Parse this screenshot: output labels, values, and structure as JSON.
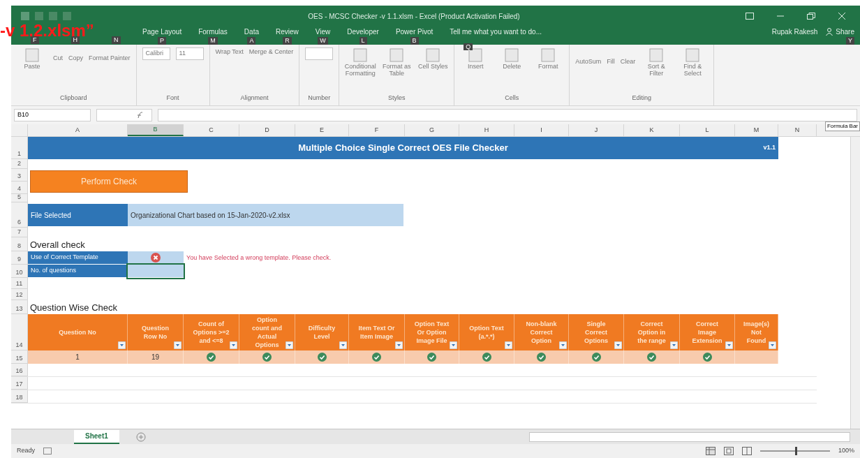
{
  "window": {
    "title": "OES - MCSC Checker -v 1.1.xlsm - Excel (Product Activation Failed)",
    "user": "Rupak Rakesh",
    "share": "Share",
    "share_keytip": "Y"
  },
  "overlay_caption": "-v 1.2.xlsm”",
  "covered_tab_keytips": [
    "F",
    "H",
    "N"
  ],
  "tabs": [
    {
      "label": "Page Layout",
      "keytip": "P"
    },
    {
      "label": "Formulas",
      "keytip": "M"
    },
    {
      "label": "Data",
      "keytip": "A"
    },
    {
      "label": "Review",
      "keytip": "R"
    },
    {
      "label": "View",
      "keytip": "W"
    },
    {
      "label": "Developer",
      "keytip": "L"
    },
    {
      "label": "Power Pivot",
      "keytip": "B"
    }
  ],
  "tell_me": {
    "label": "Tell me what you want to do...",
    "keytip": "Q"
  },
  "ribbon": [
    {
      "label": "Clipboard",
      "items": [
        {
          "kind": "large",
          "label": "Paste"
        },
        {
          "kind": "small",
          "label": "Cut"
        },
        {
          "kind": "small",
          "label": "Copy"
        },
        {
          "kind": "small",
          "label": "Format Painter"
        }
      ]
    },
    {
      "label": "Font",
      "items": [
        {
          "kind": "field",
          "label": "Calibri"
        },
        {
          "kind": "field",
          "label": "11"
        }
      ]
    },
    {
      "label": "Alignment",
      "items": [
        {
          "kind": "small",
          "label": "Wrap Text"
        },
        {
          "kind": "small",
          "label": "Merge & Center"
        }
      ]
    },
    {
      "label": "Number",
      "items": [
        {
          "kind": "field"
        }
      ]
    },
    {
      "label": "Styles",
      "items": [
        {
          "kind": "large",
          "label": "Conditional Formatting"
        },
        {
          "kind": "large",
          "label": "Format as Table"
        },
        {
          "kind": "large",
          "label": "Cell Styles"
        }
      ]
    },
    {
      "label": "Cells",
      "items": [
        {
          "kind": "large",
          "label": "Insert"
        },
        {
          "kind": "large",
          "label": "Delete"
        },
        {
          "kind": "large",
          "label": "Format"
        }
      ]
    },
    {
      "label": "Editing",
      "items": [
        {
          "kind": "small",
          "label": "AutoSum"
        },
        {
          "kind": "small",
          "label": "Fill"
        },
        {
          "kind": "small",
          "label": "Clear"
        },
        {
          "kind": "large",
          "label": "Sort & Filter"
        },
        {
          "kind": "large",
          "label": "Find & Select"
        }
      ]
    }
  ],
  "formula_bar": {
    "name_box": "B10",
    "tooltip": "Formula Bar"
  },
  "columns": [
    {
      "label": "A",
      "selected": false
    },
    {
      "label": "B",
      "selected": true
    },
    {
      "label": "C",
      "selected": false
    },
    {
      "label": "D",
      "selected": false
    },
    {
      "label": "E",
      "selected": false
    },
    {
      "label": "F",
      "selected": false
    },
    {
      "label": "G",
      "selected": false
    },
    {
      "label": "H",
      "selected": false
    },
    {
      "label": "I",
      "selected": false
    },
    {
      "label": "J",
      "selected": false
    },
    {
      "label": "K",
      "selected": false
    },
    {
      "label": "L",
      "selected": false
    },
    {
      "label": "M",
      "selected": false
    },
    {
      "label": "N",
      "selected": false
    }
  ],
  "row_numbers": [
    "1",
    "2",
    "3",
    "4",
    "5",
    "6",
    "7",
    "8",
    "9",
    "10",
    "11",
    "12",
    "13",
    "14",
    "15",
    "16",
    "17",
    "18"
  ],
  "sheet": {
    "title": "Multiple Choice Single Correct OES File Checker",
    "version": "v1.1",
    "perform_button": "Perform Check",
    "file_label": "File Selected",
    "file_value": "Organizational Chart based on 15-Jan-2020-v2.xlsx",
    "overall_heading": "Overall check",
    "checks": [
      {
        "label": "Use of Correct Template",
        "kind": "error",
        "message": "You have Selected a wrong template. Please check."
      },
      {
        "label": "No. of questions",
        "kind": "empty"
      }
    ],
    "question_heading": "Question Wise Check",
    "headers": [
      "Question No",
      "Question Row No",
      "Count of Options >=2 and <=8",
      "Option count and Actual Options",
      "Difficulty Level",
      "Item Text Or Item Image",
      "Option Text Or Option Image File",
      "Option Text (a.*.*)",
      "Non-blank Correct Option",
      "Single Correct Options",
      "Correct Option in the range",
      "Correct Image Extension",
      "Image(s) Not Found"
    ],
    "rows": [
      {
        "cells": [
          {
            "kind": "text",
            "value": "1"
          },
          {
            "kind": "text",
            "value": "19"
          },
          {
            "kind": "ok"
          },
          {
            "kind": "ok"
          },
          {
            "kind": "ok"
          },
          {
            "kind": "ok"
          },
          {
            "kind": "ok"
          },
          {
            "kind": "ok"
          },
          {
            "kind": "ok"
          },
          {
            "kind": "ok"
          },
          {
            "kind": "ok"
          },
          {
            "kind": "ok"
          },
          {
            "kind": "empty"
          }
        ]
      }
    ]
  },
  "sheet_tabs": [
    {
      "label": "Sheet1",
      "selected": true
    }
  ],
  "status_bar": {
    "status": "Ready",
    "zoom": "100%",
    "zoom_slider": {
      "level": 0.5
    }
  }
}
